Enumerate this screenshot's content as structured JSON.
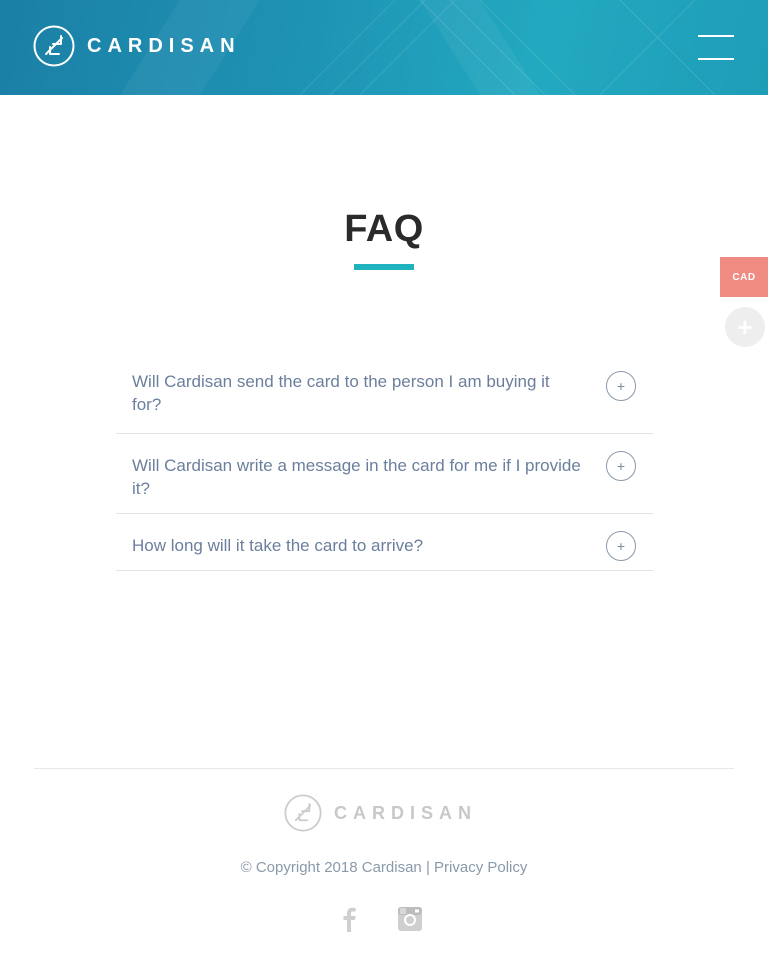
{
  "header": {
    "brand": "CARDISAN"
  },
  "side": {
    "currency": "CAD",
    "plus": "+"
  },
  "main": {
    "title": "FAQ",
    "faq": [
      {
        "question": "Will Cardisan send the card to the person I am buying it for?",
        "toggle": "+"
      },
      {
        "question": "Will Cardisan write a message in the card for me if I provide it?",
        "toggle": "+"
      },
      {
        "question": "How long will it take the card to arrive?",
        "toggle": "+"
      }
    ]
  },
  "footer": {
    "brand": "CARDISAN",
    "copyright": "© Copyright 2018 Cardisan |",
    "privacy": "Privacy Policy",
    "social": [
      "facebook-icon",
      "instagram-icon"
    ]
  },
  "colors": {
    "accent": "#1fb3c0",
    "header_gradient_start": "#1b7fa6",
    "header_gradient_end": "#22a9c0",
    "currency_badge": "#f08b82",
    "faq_text": "#6b7f9d"
  }
}
